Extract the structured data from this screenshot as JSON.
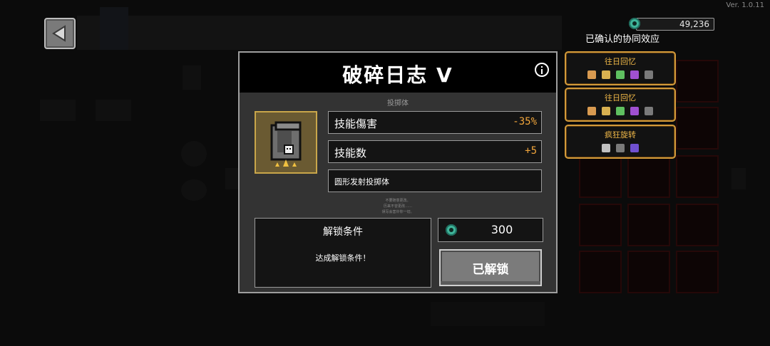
{
  "version": "Ver. 1.0.11",
  "currency": {
    "amount": "49,236",
    "icon": "gem-icon"
  },
  "synergy": {
    "title": "已确认的协同效应",
    "cards": [
      {
        "name": "往日回忆",
        "icons": [
          "#d89a50",
          "#d8b050",
          "#5fc060",
          "#a050d0",
          "#7a7a7a"
        ]
      },
      {
        "name": "往日回忆",
        "icons": [
          "#d89a50",
          "#d8b050",
          "#5fc060",
          "#a050d0",
          "#7a7a7a"
        ]
      },
      {
        "name": "疯狂旋转",
        "icons": [
          "#c0c0c0",
          "#7a7a7a",
          "#7050d0"
        ]
      }
    ]
  },
  "modal": {
    "title": "破碎日志 V",
    "subtitle": "投掷体",
    "stats": [
      {
        "label": "技能傷害",
        "value": "-35%"
      },
      {
        "label": "技能数",
        "value": "+5"
      }
    ],
    "description": "圆形发射投掷体",
    "flavor": [
      "不要随意更改。",
      "历来不曾更改……",
      "误写会害许你一切。"
    ],
    "unlock_title": "解锁条件",
    "unlock_condition": "达成解锁条件！",
    "cost": "300",
    "unlocked_label": "已解锁",
    "rarity_stars": 3
  },
  "colors": {
    "accent": "#f2a63b",
    "frame_gold": "#d39a3a",
    "gem": "#3fb59a"
  }
}
